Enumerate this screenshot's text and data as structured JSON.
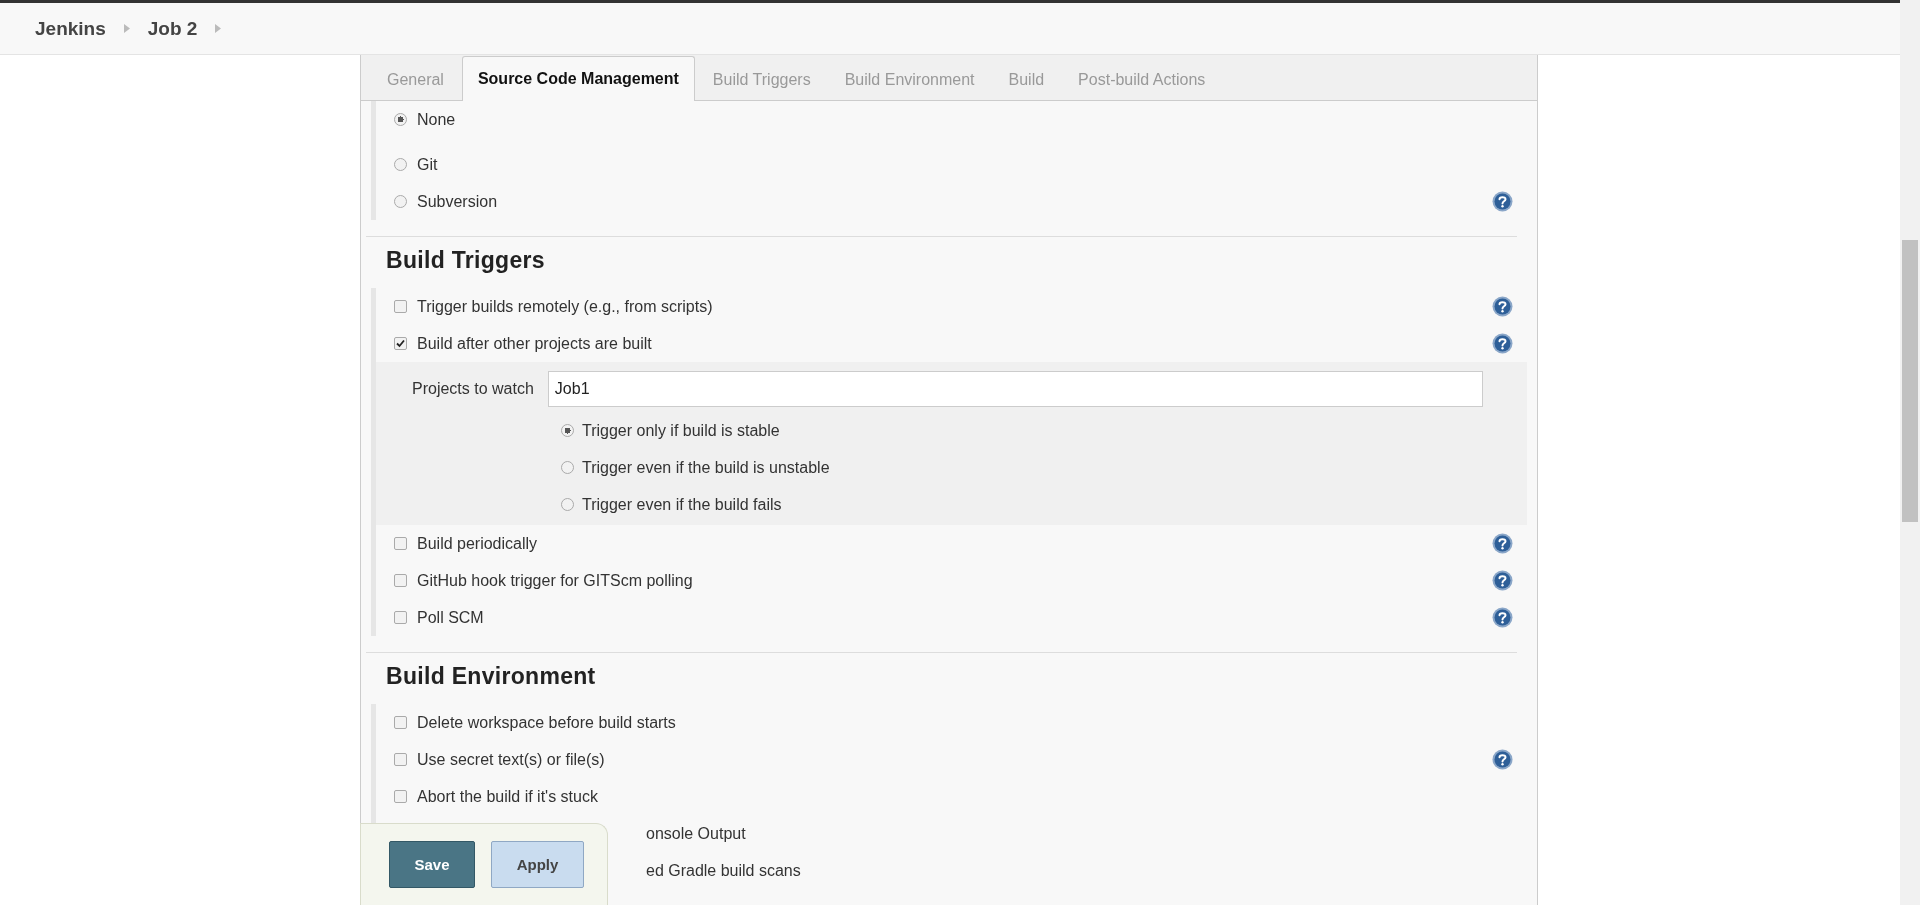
{
  "breadcrumbs": [
    {
      "label": "Jenkins"
    },
    {
      "label": "Job 2"
    }
  ],
  "tabs": [
    {
      "label": "General",
      "selected": false
    },
    {
      "label": "Source Code Management",
      "selected": true
    },
    {
      "label": "Build Triggers",
      "selected": false
    },
    {
      "label": "Build Environment",
      "selected": false
    },
    {
      "label": "Build",
      "selected": false
    },
    {
      "label": "Post-build Actions",
      "selected": false
    }
  ],
  "scm": {
    "options": [
      {
        "label": "None",
        "selected": true,
        "help": false
      },
      {
        "label": "Git",
        "selected": false,
        "help": false
      },
      {
        "label": "Subversion",
        "selected": false,
        "help": true
      }
    ]
  },
  "sections": [
    {
      "title": "Build Triggers",
      "items": [
        {
          "label": "Trigger builds remotely (e.g., from scripts)",
          "checked": false,
          "help": true
        },
        {
          "label": "Build after other projects are built",
          "checked": true,
          "help": true,
          "details": {
            "field_label": "Projects to watch",
            "value": "Job1",
            "options": [
              {
                "label": "Trigger only if build is stable",
                "selected": true
              },
              {
                "label": "Trigger even if the build is unstable",
                "selected": false
              },
              {
                "label": "Trigger even if the build fails",
                "selected": false
              }
            ]
          }
        },
        {
          "label": "Build periodically",
          "checked": false,
          "help": true
        },
        {
          "label": "GitHub hook trigger for GITScm polling",
          "checked": false,
          "help": true
        },
        {
          "label": "Poll SCM",
          "checked": false,
          "help": true
        }
      ]
    },
    {
      "title": "Build Environment",
      "items": [
        {
          "label": "Delete workspace before build starts",
          "checked": false,
          "help": false
        },
        {
          "label": "Use secret text(s) or file(s)",
          "checked": false,
          "help": true
        },
        {
          "label": "Abort the build if it's stuck",
          "checked": false,
          "help": false
        },
        {
          "label": "onsole Output",
          "covered": true,
          "help": false
        },
        {
          "label": "ed Gradle build scans",
          "covered": true,
          "help": false
        }
      ]
    }
  ],
  "actions": {
    "save": "Save",
    "apply": "Apply"
  }
}
